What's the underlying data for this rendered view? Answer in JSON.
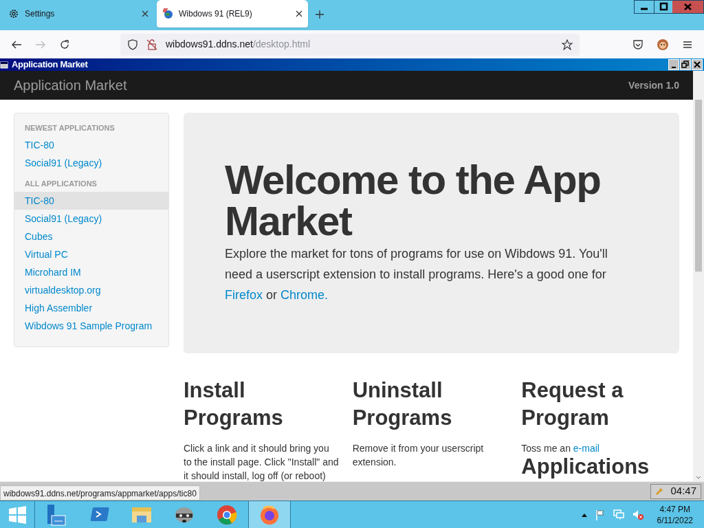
{
  "browser": {
    "tabs": [
      {
        "title": "Settings",
        "kind": "settings",
        "selected": false
      },
      {
        "title": "Wibdows 91 (REL9)",
        "kind": "site",
        "selected": true
      }
    ],
    "url_host": "wibdows91.ddns.net",
    "url_path": "/desktop.html"
  },
  "window": {
    "title": "Application Market"
  },
  "header": {
    "title": "Application Market",
    "version": "Version 1.0"
  },
  "sidebar": {
    "sections": [
      {
        "heading": "NEWEST APPLICATIONS",
        "items": [
          {
            "label": "TIC-80",
            "selected": false
          },
          {
            "label": "Social91 (Legacy)",
            "selected": false
          }
        ]
      },
      {
        "heading": "ALL APPLICATIONS",
        "items": [
          {
            "label": "TIC-80",
            "selected": true
          },
          {
            "label": "Social91 (Legacy)",
            "selected": false
          },
          {
            "label": "Cubes",
            "selected": false
          },
          {
            "label": "Virtual PC",
            "selected": false
          },
          {
            "label": "Microhard IM",
            "selected": false
          },
          {
            "label": "virtualdesktop.org",
            "selected": false
          },
          {
            "label": "High Assembler",
            "selected": false
          },
          {
            "label": "Wibdows 91 Sample Program",
            "selected": false
          }
        ]
      }
    ]
  },
  "hero": {
    "title": "Welcome to the App Market",
    "text": "Explore the market for tons of programs for use on Wibdows 91. You'll need a userscript extension to install programs. Here's a good one for",
    "link_1": "Firefox",
    "joiner": "or",
    "link_2": "Chrome."
  },
  "columns": [
    {
      "title": "Install Programs",
      "text": "Click a link and it should bring you to the install page. Click \"Install\" and it should install, log off (or reboot)"
    },
    {
      "title": "Uninstall Programs",
      "text": "Remove it from your userscript extension."
    },
    {
      "title": "Request a Program",
      "text": "Toss me an",
      "link": "e-mail",
      "next_title": "Applications"
    }
  ],
  "status_bar": {
    "url": "wibdows91.ddns.net/programs/appmarket/apps/tic80",
    "clock": "04:47"
  },
  "taskbar": {
    "apps": [
      {
        "kind": "server",
        "selected": false
      },
      {
        "kind": "shell",
        "selected": false
      },
      {
        "kind": "folder",
        "selected": false
      },
      {
        "kind": "raccoon",
        "selected": false
      },
      {
        "kind": "chrome",
        "selected": false
      },
      {
        "kind": "firefox",
        "selected": true
      }
    ],
    "time": "4:47 PM",
    "date": "6/11/2022"
  }
}
